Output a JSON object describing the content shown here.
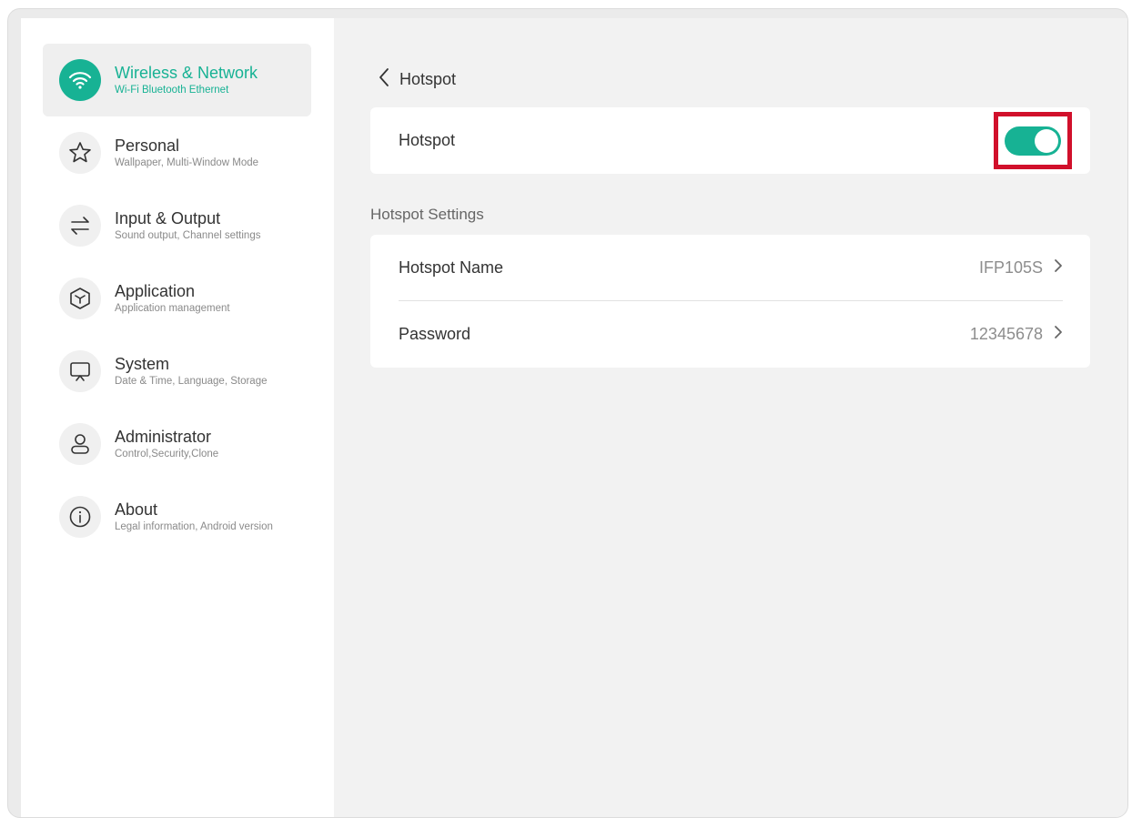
{
  "sidebar": {
    "items": [
      {
        "label": "Wireless & Network",
        "subtitle": "Wi-Fi Bluetooth Ethernet",
        "icon": "wifi-icon",
        "active": true
      },
      {
        "label": "Personal",
        "subtitle": "Wallpaper, Multi-Window Mode",
        "icon": "star-icon"
      },
      {
        "label": "Input & Output",
        "subtitle": "Sound output, Channel settings",
        "icon": "swap-arrows-icon"
      },
      {
        "label": "Application",
        "subtitle": "Application management",
        "icon": "cube-icon"
      },
      {
        "label": "System",
        "subtitle": "Date & Time, Language, Storage",
        "icon": "monitor-icon"
      },
      {
        "label": "Administrator",
        "subtitle": "Control,Security,Clone",
        "icon": "user-icon"
      },
      {
        "label": "About",
        "subtitle": "Legal information, Android version",
        "icon": "info-icon"
      }
    ]
  },
  "main": {
    "page_title": "Hotspot",
    "hotspot_toggle": {
      "label": "Hotspot",
      "on": true
    },
    "section_header": "Hotspot Settings",
    "settings": [
      {
        "label": "Hotspot Name",
        "value": "IFP105S"
      },
      {
        "label": "Password",
        "value": "12345678"
      }
    ]
  },
  "colors": {
    "accent": "#17b294",
    "highlight": "#d1102b"
  }
}
